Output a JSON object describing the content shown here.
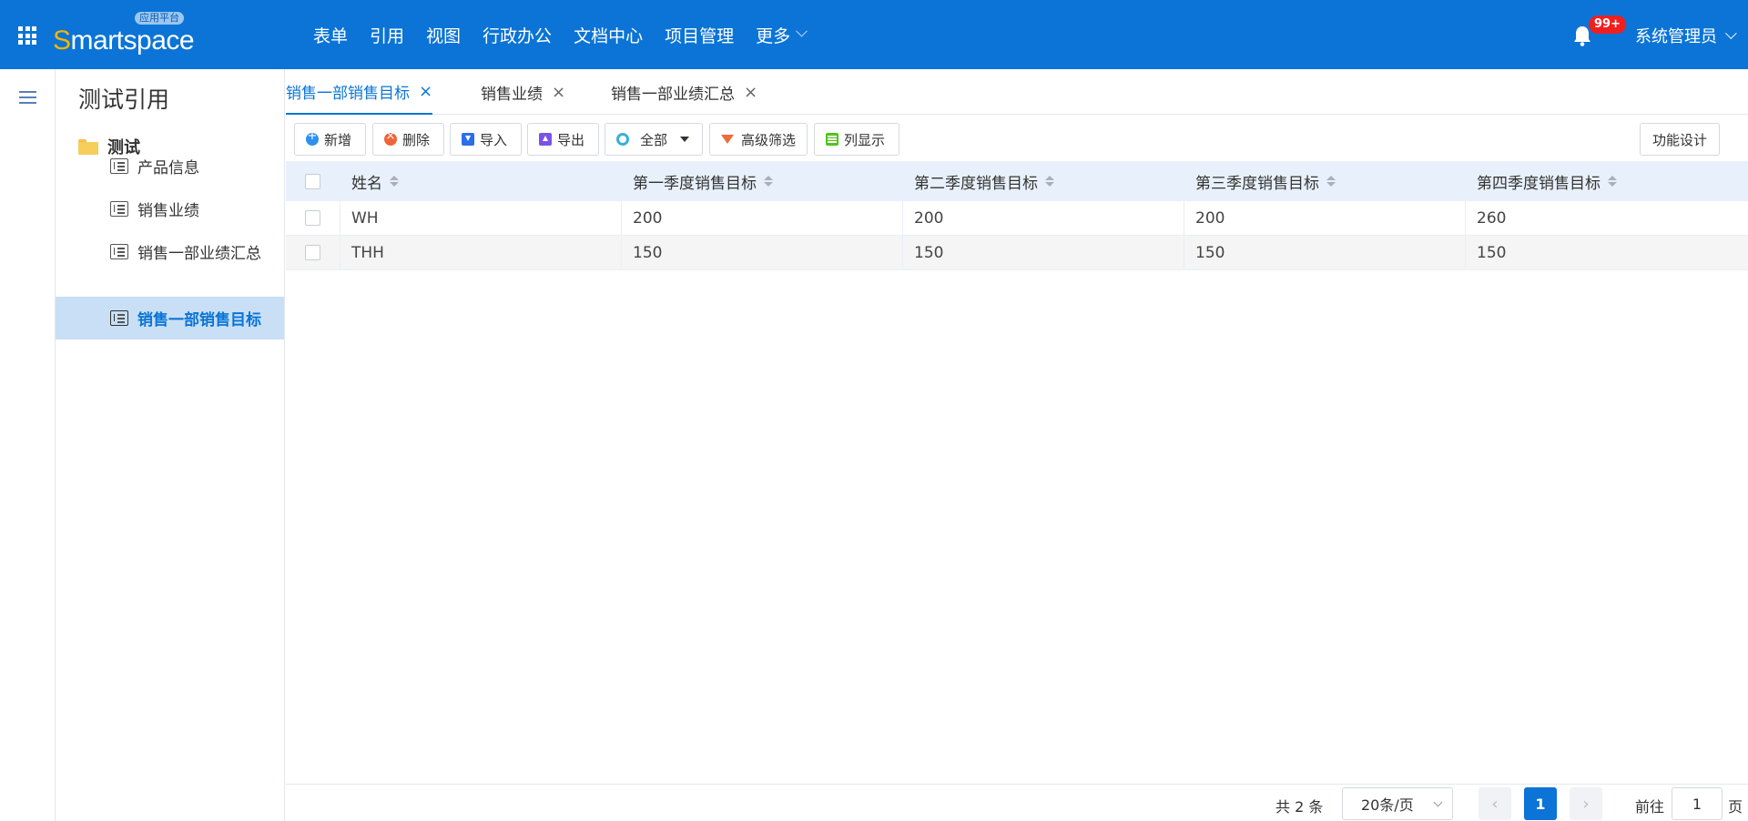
{
  "header": {
    "logo_text_first": "S",
    "logo_text_rest": "martspace",
    "logo_badge": "应用平台",
    "nav": [
      "表单",
      "引用",
      "视图",
      "行政办公",
      "文档中心",
      "项目管理",
      "更多"
    ],
    "notification_count": "99+",
    "user_name": "系统管理员"
  },
  "sidebar": {
    "title": "测试引用",
    "folder": "测试",
    "items": [
      {
        "label": "产品信息"
      },
      {
        "label": "销售业绩"
      },
      {
        "label": "销售一部业绩汇总"
      },
      {
        "label": "销售一部销售目标"
      }
    ]
  },
  "tabs": [
    {
      "label": "销售一部销售目标",
      "close": "×"
    },
    {
      "label": "销售业绩",
      "close": "×"
    },
    {
      "label": "销售一部业绩汇总",
      "close": "×"
    }
  ],
  "toolbar": {
    "add": "新增",
    "delete": "删除",
    "import": "导入",
    "export": "导出",
    "all": "全部",
    "filter": "高级筛选",
    "columns": "列显示",
    "design": "功能设计"
  },
  "table": {
    "columns": [
      "姓名",
      "第一季度销售目标",
      "第二季度销售目标",
      "第三季度销售目标",
      "第四季度销售目标"
    ],
    "rows": [
      [
        "WH",
        "200",
        "200",
        "200",
        "260"
      ],
      [
        "THH",
        "150",
        "150",
        "150",
        "150"
      ]
    ]
  },
  "pagination": {
    "total": "共 2 条",
    "page_size": "20条/页",
    "prev": "‹",
    "current": "1",
    "next": "›",
    "goto_label": "前往",
    "goto_value": "1",
    "page_suffix": "页"
  }
}
